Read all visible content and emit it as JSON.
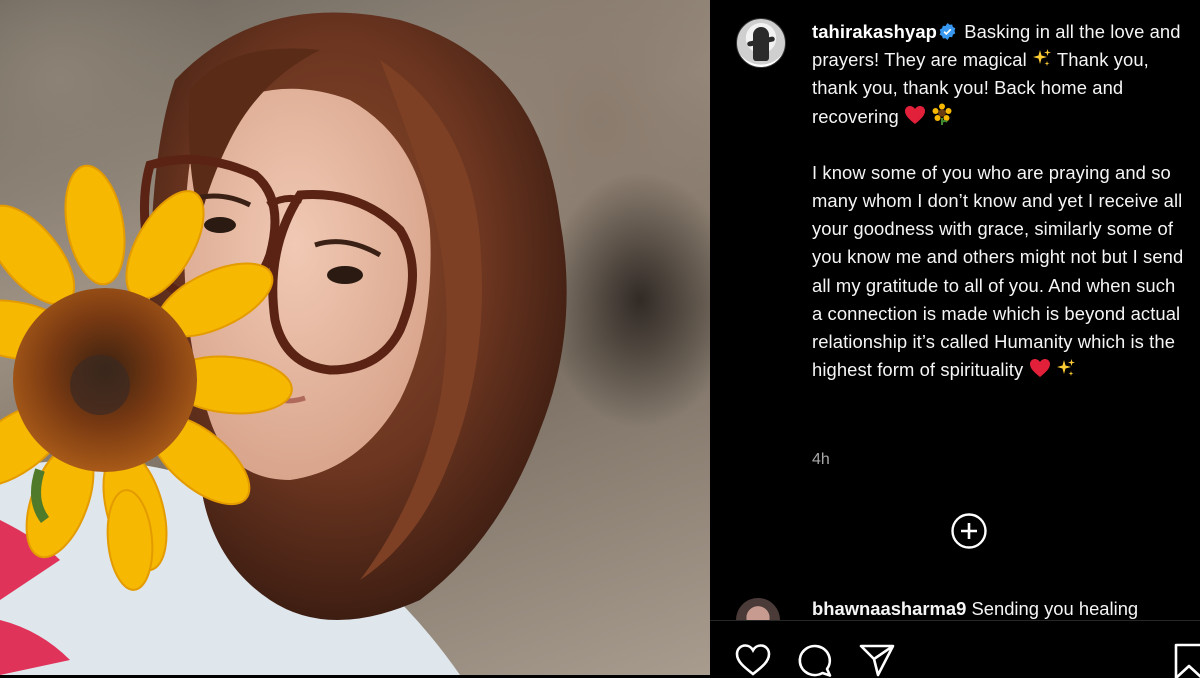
{
  "post": {
    "username": "tahirakashyap",
    "caption_lines_1": [
      "Basking in all the love and prayers! They are magical ✨ Thank you, thank you, thank you! Back home and recovering"
    ],
    "caption_part1": "Basking in all the love and prayers! They are magical",
    "caption_part2": "Thank you, thank you, thank you! Back home and recovering",
    "caption_part3": "I know some of you who are praying and so many whom I don’t know and yet I receive all your goodness with grace, similarly some of you know me and others might not but I send all my gratitude to all of you. And when such a connection is made which is beyond actual relationship it’s called Humanity which is the highest form of spirituality",
    "time": "4h"
  },
  "comment": {
    "username": "bhawnaasharma9",
    "text": "Sending you healing"
  },
  "icons": {
    "verified": "verified-badge-icon",
    "sparkles": "sparkles-icon",
    "heart_emoji": "red-heart-icon",
    "sunflower_emoji": "sunflower-icon",
    "add": "add-comment-icon",
    "like": "heart-outline-icon",
    "comment": "comment-icon",
    "share": "send-icon",
    "save": "bookmark-icon"
  },
  "colors": {
    "background": "#000000",
    "verified": "#3897f0",
    "muted": "#a8a8a8"
  }
}
